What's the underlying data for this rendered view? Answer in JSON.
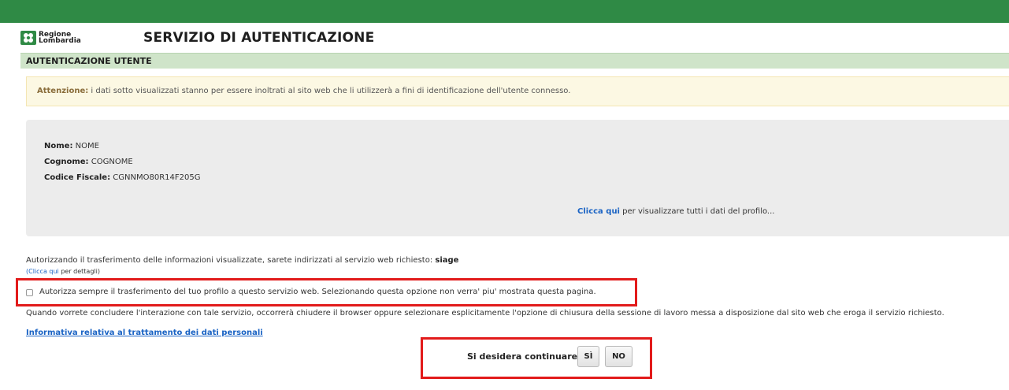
{
  "brand": {
    "logo_line1": "Regione",
    "logo_line2": "Lombardia",
    "accent": "#2f8a45"
  },
  "header": {
    "title": "SERVIZIO DI AUTENTICAZIONE"
  },
  "section": {
    "title": "AUTENTICAZIONE UTENTE"
  },
  "warning": {
    "label": "Attenzione:",
    "text": " i dati sotto visualizzati stanno per essere inoltrati al sito web che li utilizzerà a fini di identificazione dell'utente connesso."
  },
  "profile": {
    "fields": [
      {
        "label": "Nome:",
        "value": "NOME"
      },
      {
        "label": "Cognome:",
        "value": "COGNOME"
      },
      {
        "label": "Codice Fiscale:",
        "value": "CGNNMO80R14F205G"
      }
    ],
    "link_text": "Clicca qui",
    "link_suffix": " per visualizzare tutti i dati del profilo..."
  },
  "authorization": {
    "text": "Autorizzando il trasferimento delle informazioni visualizzate, sarete indirizzati al servizio web richiesto:",
    "service": "siage",
    "details_prefix": "(",
    "details_link": "Clicca qui",
    "details_suffix": " per dettagli)"
  },
  "always_authorize": {
    "label": "Autorizza sempre il trasferimento del tuo profilo a questo servizio web. Selezionando questa opzione non verra' piu' mostrata questa pagina.",
    "checked": false
  },
  "closing": {
    "text": "Quando vorrete concludere l'interazione con tale servizio, occorrerà chiudere il browser oppure selezionare esplicitamente l'opzione di chiusura della sessione di lavoro messa a disposizione dal sito web che eroga il servizio richiesto."
  },
  "privacy": {
    "link": "Informativa relativa al trattamento dei dati personali"
  },
  "confirm": {
    "question": "Si desidera continuare?",
    "yes": "SÌ",
    "no": "NO"
  }
}
